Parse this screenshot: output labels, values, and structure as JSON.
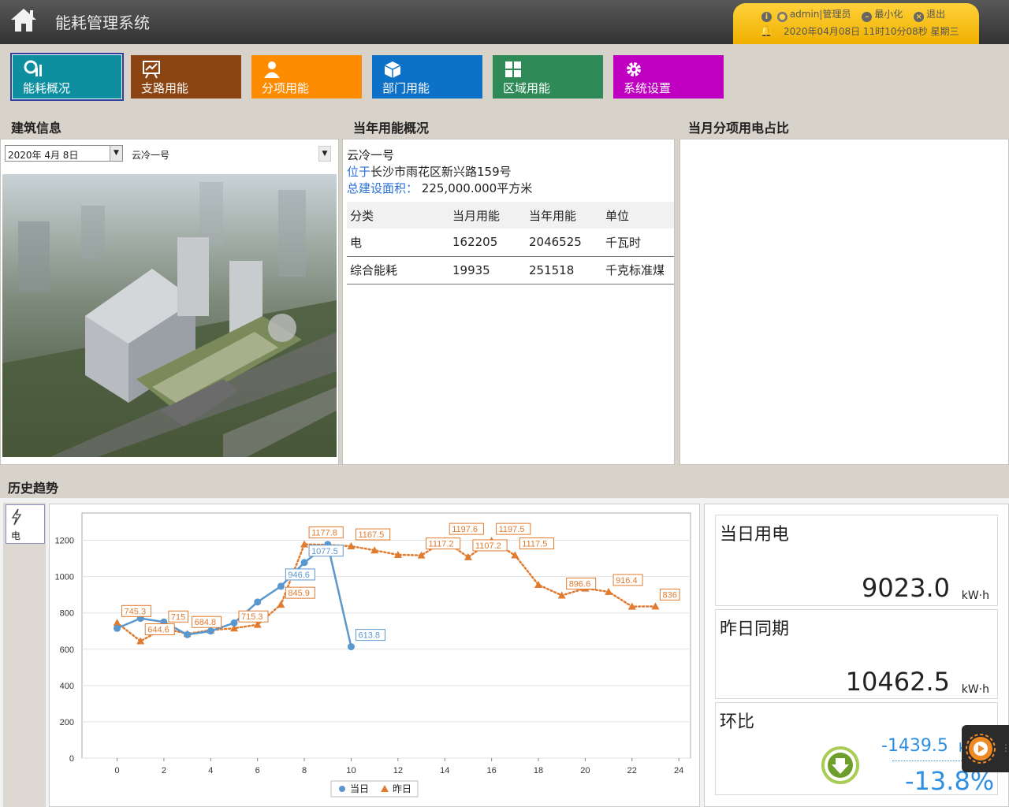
{
  "header": {
    "title": "能耗管理系统",
    "user": "admin|管理员",
    "minimize_label": "最小化",
    "exit_label": "退出",
    "datetime": "2020年04月08日 11时10分08秒 星期三"
  },
  "nav": [
    {
      "label": "能耗概况",
      "color": "#0e8fa0",
      "icon": "dashboard-icon"
    },
    {
      "label": "支路用能",
      "color": "#8b4513",
      "icon": "trend-board-icon"
    },
    {
      "label": "分项用能",
      "color": "#ff8c00",
      "icon": "user-icon"
    },
    {
      "label": "部门用能",
      "color": "#0d72c7",
      "icon": "cube-icon"
    },
    {
      "label": "区域用能",
      "color": "#2e8b57",
      "icon": "grid-icon"
    },
    {
      "label": "系统设置",
      "color": "#c000c0",
      "icon": "gear-icon"
    }
  ],
  "building": {
    "heading": "建筑信息",
    "date_value": "2020年  4月  8日",
    "building_value": "云冷一号"
  },
  "overview": {
    "heading": "当年用能概况",
    "name": "云冷一号",
    "location_label": "位于",
    "location": "长沙市雨花区新兴路159号",
    "area_label": "总建设面积：",
    "area": "225,000.000平方米",
    "table": {
      "headers": [
        "分类",
        "当月用能",
        "当年用能",
        "单位"
      ],
      "rows": [
        [
          "电",
          "162205",
          "2046525",
          "千瓦时"
        ],
        [
          "综合能耗",
          "19935",
          "251518",
          "千克标准煤"
        ]
      ]
    }
  },
  "ratio": {
    "heading": "当月分项用电占比"
  },
  "history": {
    "heading": "历史趋势",
    "side_tab_label": "电"
  },
  "stats": {
    "today_title": "当日用电",
    "today_value": "9023.0",
    "unit": "kW·h",
    "yesterday_title": "昨日同期",
    "yesterday_value": "10462.5",
    "ratio_title": "环比",
    "diff_value": "-1439.5",
    "diff_unit": "k",
    "percent_value": "-13.8%"
  },
  "chart_data": {
    "type": "line",
    "xlim": [
      -1.5,
      24.5
    ],
    "ylim": [
      0,
      1350
    ],
    "xticks": [
      0,
      2,
      4,
      6,
      8,
      10,
      12,
      14,
      16,
      18,
      20,
      22,
      24
    ],
    "yticks": [
      0,
      200,
      400,
      600,
      800,
      1000,
      1200
    ],
    "legend_position": "bottom-center",
    "series": [
      {
        "name": "当日",
        "color": "#5b97cf",
        "style": "solid-circle",
        "x": [
          0,
          1,
          2,
          3,
          4,
          5,
          6,
          7,
          8,
          9,
          10
        ],
        "y": [
          715,
          770,
          750,
          680,
          700,
          745,
          860,
          946.6,
          1077.5,
          1177,
          613.8
        ],
        "labels": [
          {
            "x": 7,
            "y": 946.6,
            "text": "946.6"
          },
          {
            "x": 8,
            "y": 1077.5,
            "text": "1077.5"
          },
          {
            "x": 10,
            "y": 613.8,
            "text": "613.8"
          }
        ]
      },
      {
        "name": "昨日",
        "color": "#e07b30",
        "style": "dotted-triangle",
        "x": [
          0,
          1,
          2,
          3,
          4,
          5,
          6,
          7,
          8,
          9,
          10,
          11,
          12,
          13,
          14,
          15,
          16,
          17,
          18,
          19,
          20,
          21,
          22,
          23
        ],
        "y": [
          745.3,
          644.6,
          715,
          684.8,
          705,
          715.3,
          735,
          845.9,
          1177.8,
          1175,
          1167.5,
          1145,
          1120,
          1117.2,
          1197.6,
          1107.2,
          1197.5,
          1117.5,
          955,
          896.6,
          935,
          916.4,
          835,
          836
        ],
        "labels": [
          {
            "x": 0,
            "y": 745.3,
            "text": "745.3"
          },
          {
            "x": 1,
            "y": 644.6,
            "text": "644.6"
          },
          {
            "x": 2,
            "y": 715,
            "text": "715"
          },
          {
            "x": 3,
            "y": 684.8,
            "text": "684.8"
          },
          {
            "x": 5,
            "y": 715.3,
            "text": "715.3"
          },
          {
            "x": 7,
            "y": 845.9,
            "text": "845.9"
          },
          {
            "x": 8,
            "y": 1177.8,
            "text": "1177.8"
          },
          {
            "x": 10,
            "y": 1167.5,
            "text": "1167.5"
          },
          {
            "x": 13,
            "y": 1117.2,
            "text": "1117.2"
          },
          {
            "x": 14,
            "y": 1197.6,
            "text": "1197.6"
          },
          {
            "x": 15,
            "y": 1107.2,
            "text": "1107.2"
          },
          {
            "x": 16,
            "y": 1197.5,
            "text": "1197.5"
          },
          {
            "x": 17,
            "y": 1117.5,
            "text": "1117.5"
          },
          {
            "x": 19,
            "y": 896.6,
            "text": "896.6"
          },
          {
            "x": 21,
            "y": 916.4,
            "text": "916.4"
          },
          {
            "x": 23,
            "y": 836,
            "text": "836"
          }
        ]
      }
    ]
  }
}
